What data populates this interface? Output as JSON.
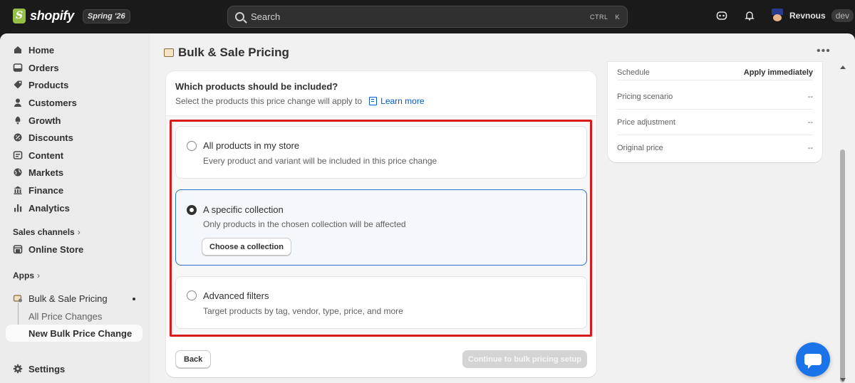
{
  "topbar": {
    "logo_text": "shopify",
    "edition": "Spring '26",
    "search_placeholder": "Search",
    "search_shortcut_ctrl": "CTRL",
    "search_shortcut_key": "K",
    "user_name": "Revnous",
    "user_badge": "dev"
  },
  "sidebar": {
    "items": [
      {
        "label": "Home",
        "icon": "home-icon"
      },
      {
        "label": "Orders",
        "icon": "orders-icon"
      },
      {
        "label": "Products",
        "icon": "tag-icon"
      },
      {
        "label": "Customers",
        "icon": "person-icon"
      },
      {
        "label": "Growth",
        "icon": "growth-icon"
      },
      {
        "label": "Discounts",
        "icon": "discount-icon"
      },
      {
        "label": "Content",
        "icon": "content-icon"
      },
      {
        "label": "Markets",
        "icon": "globe-icon"
      },
      {
        "label": "Finance",
        "icon": "bank-icon"
      },
      {
        "label": "Analytics",
        "icon": "bar-chart-icon"
      }
    ],
    "sales_channels_label": "Sales channels",
    "online_store_label": "Online Store",
    "apps_label": "Apps",
    "app_name": "Bulk & Sale Pricing",
    "app_sub_items": [
      "All Price Changes",
      "New Bulk Price Change"
    ],
    "settings_label": "Settings"
  },
  "page": {
    "title": "Bulk & Sale Pricing"
  },
  "main": {
    "question": "Which products should be included?",
    "subtitle": "Select the products this price change will apply to",
    "learn_more": "Learn more",
    "options": [
      {
        "title": "All products in my store",
        "desc": "Every product and variant will be included in this price change",
        "selected": false
      },
      {
        "title": "A specific collection",
        "desc": "Only products in the chosen collection will be affected",
        "selected": true
      },
      {
        "title": "Advanced filters",
        "desc": "Target products by tag, vendor, type, price, and more",
        "selected": false
      }
    ],
    "choose_collection": "Choose a collection",
    "back": "Back",
    "continue": "Continue to bulk pricing setup"
  },
  "summary": {
    "rows": [
      {
        "label": "Schedule",
        "value": "Apply immediately"
      },
      {
        "label": "Pricing scenario",
        "value": "--"
      },
      {
        "label": "Price adjustment",
        "value": "--"
      },
      {
        "label": "Original price",
        "value": "--"
      }
    ]
  },
  "colors": {
    "accent_blue": "#005bd3",
    "selected_border": "#2c6ecb",
    "highlight_red": "#d91a1a",
    "topbar": "#1a1a1a",
    "chat": "#1a73e8"
  }
}
